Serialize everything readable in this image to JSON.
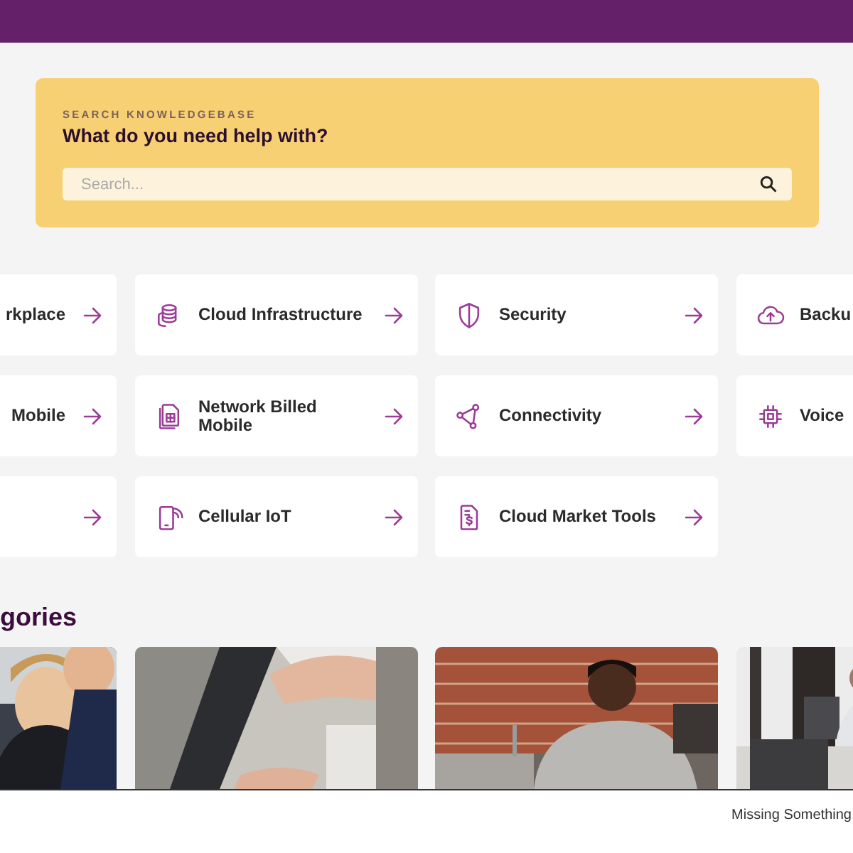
{
  "header_bar": {
    "kind": "bar"
  },
  "search": {
    "eyebrow": "SEARCH KNOWLEDGEBASE",
    "title": "What do you need help with?",
    "placeholder": "Search..."
  },
  "topics": [
    {
      "label": "rkplace",
      "kind": "none"
    },
    {
      "label": "Cloud Infrastructure",
      "kind": "database"
    },
    {
      "label": "Security",
      "kind": "shield"
    },
    {
      "label": "Backu",
      "kind": "cloud"
    },
    {
      "label": "Mobile",
      "kind": "none"
    },
    {
      "label": "Network Billed Mobile",
      "kind": "sim"
    },
    {
      "label": "Connectivity",
      "kind": "nodes"
    },
    {
      "label": "Voice",
      "kind": "chip"
    },
    {
      "kind": "none"
    },
    {
      "label": "Cellular IoT",
      "kind": "phone"
    },
    {
      "label": "Cloud Market Tools",
      "kind": "invoice"
    }
  ],
  "categories": {
    "heading": "gories"
  },
  "footer": {
    "text": "Missing Something"
  }
}
